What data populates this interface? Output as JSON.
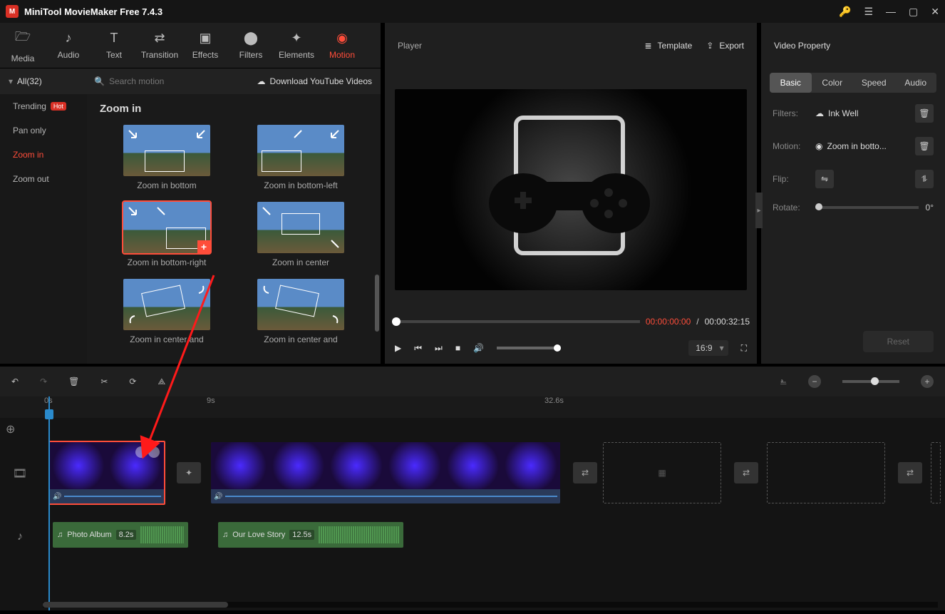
{
  "title": "MiniTool MovieMaker Free 7.4.3",
  "tabs": {
    "media": "Media",
    "audio": "Audio",
    "text": "Text",
    "transition": "Transition",
    "effects": "Effects",
    "filters": "Filters",
    "elements": "Elements",
    "motion": "Motion"
  },
  "cat": {
    "all": "All(32)",
    "trending": "Trending",
    "hot": "Hot",
    "panonly": "Pan only",
    "zoomin": "Zoom in",
    "zoomout": "Zoom out"
  },
  "search_ph": "Search motion",
  "ytlink": "Download YouTube Videos",
  "section_title": "Zoom in",
  "items": {
    "i1": "Zoom in bottom",
    "i2": "Zoom in bottom-left",
    "i3": "Zoom in bottom-right",
    "i4": "Zoom in center",
    "i5": "Zoom in center and",
    "i6": "Zoom in center and"
  },
  "player": {
    "title": "Player",
    "template": "Template",
    "export": "Export",
    "cur": "00:00:00:00",
    "sep": " / ",
    "tot": "00:00:32:15",
    "ratio": "16:9"
  },
  "prop": {
    "title": "Video Property",
    "t_basic": "Basic",
    "t_color": "Color",
    "t_speed": "Speed",
    "t_audio": "Audio",
    "filters_l": "Filters:",
    "filters_v": "Ink Well",
    "motion_l": "Motion:",
    "motion_v": "Zoom in botto...",
    "flip_l": "Flip:",
    "rotate_l": "Rotate:",
    "rotate_v": "0°",
    "reset": "Reset"
  },
  "ruler": {
    "t0": "0s",
    "t1": "9s",
    "t2": "32.6s"
  },
  "audio": {
    "a1": "Photo Album",
    "a1d": "8.2s",
    "a2": "Our Love Story",
    "a2d": "12.5s"
  }
}
